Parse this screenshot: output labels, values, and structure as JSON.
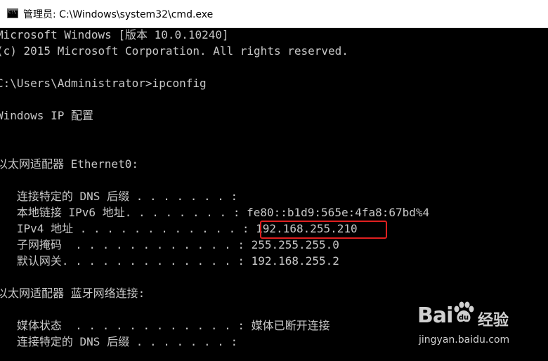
{
  "window": {
    "title": "管理员: C:\\Windows\\system32\\cmd.exe",
    "icon": "cmd-icon",
    "icon_text": "C:\\"
  },
  "console": {
    "lines": [
      "Microsoft Windows [版本 10.0.10240]",
      "(c) 2015 Microsoft Corporation. All rights reserved.",
      "",
      "C:\\Users\\Administrator>ipconfig",
      "",
      "Windows IP 配置",
      "",
      "",
      "以太网适配器 Ethernet0:",
      "",
      "   连接特定的 DNS 后缀 . . . . . . . :",
      "   本地链接 IPv6 地址. . . . . . . . : fe80::b1d9:565e:4fa8:67bd%4",
      "   IPv4 地址 . . . . . . . . . . . . : 192.168.255.210",
      "   子网掩码  . . . . . . . . . . . . : 255.255.255.0",
      "   默认网关. . . . . . . . . . . . . : 192.168.255.2",
      "",
      "以太网适配器 蓝牙网络连接:",
      "",
      "   媒体状态  . . . . . . . . . . . . : 媒体已断开连接",
      "   连接特定的 DNS 后缀 . . . . . . . :"
    ]
  },
  "highlight": {
    "label": "192.168.255.210",
    "color": "#e02020"
  },
  "watermark": {
    "logo": "Bai",
    "logo_suffix": "经验",
    "url": "jingyan.baidu.com"
  },
  "colors": {
    "console_bg": "#000000",
    "console_fg": "#c8c8c8",
    "titlebar_bg": "#ffffff"
  }
}
